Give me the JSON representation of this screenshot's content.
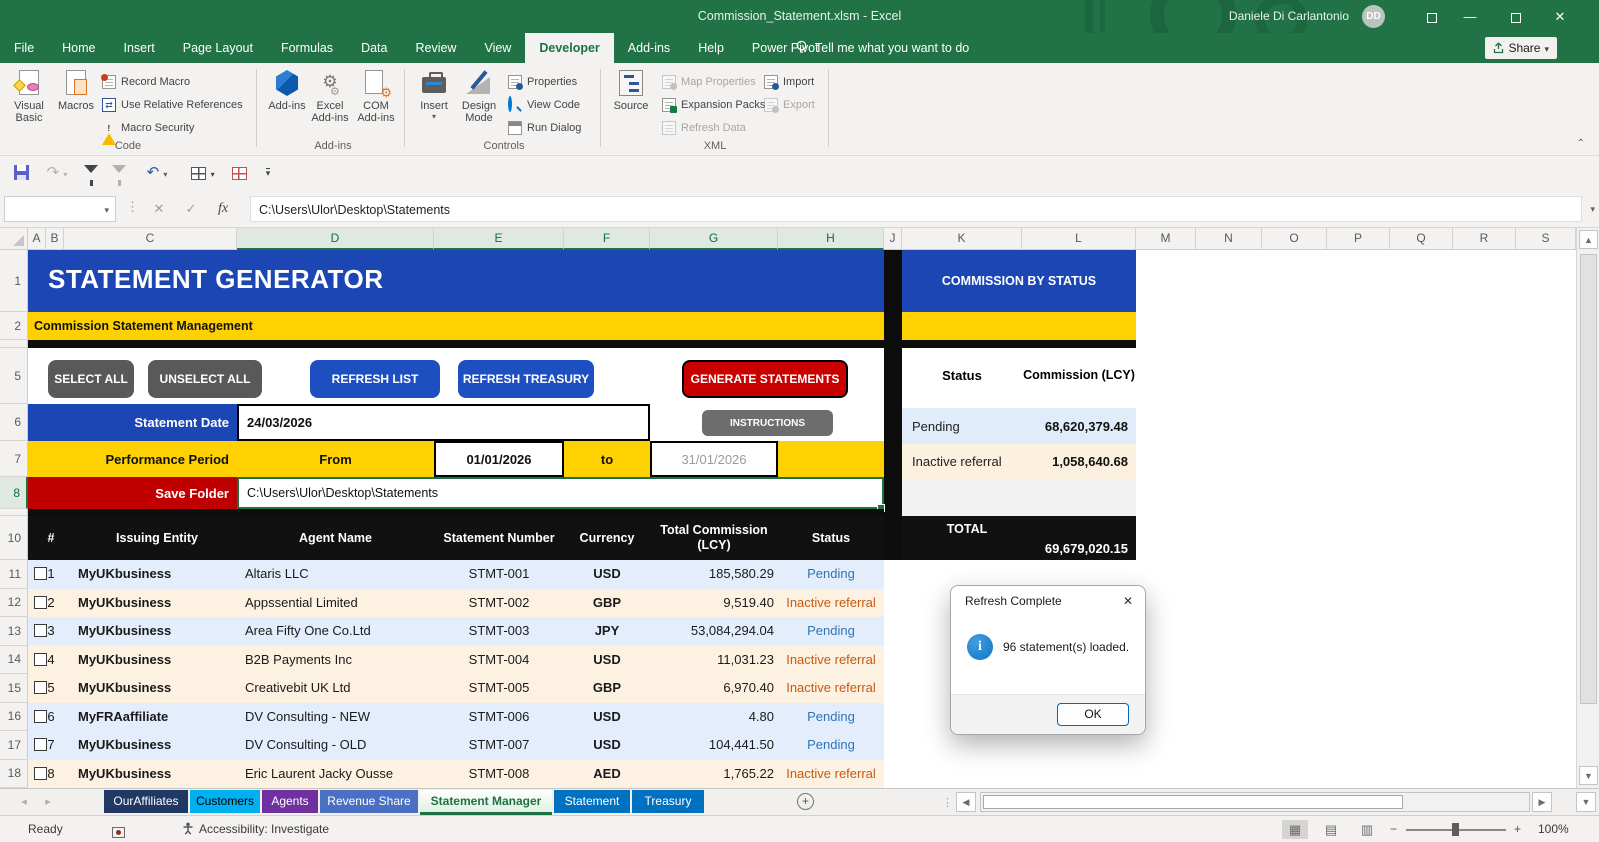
{
  "colors": {
    "excel_green": "#217346",
    "banner_blue": "#1c46b4",
    "banner_yellow": "#ffd100",
    "alert_red": "#c00000",
    "pending_blue": "#2e75b6",
    "inactive_orange": "#c55a11",
    "pending_row_bg": "#e4edfb",
    "inactive_row_bg": "#fdf2e2"
  },
  "title_bar": {
    "title": "Commission_Statement.xlsm  -  Excel",
    "user": "Daniele Di Carlantonio",
    "initials": "DD"
  },
  "ribbon_tabs": {
    "items": [
      "File",
      "Home",
      "Insert",
      "Page Layout",
      "Formulas",
      "Data",
      "Review",
      "View",
      "Developer",
      "Add-ins",
      "Help",
      "Power Pivot"
    ],
    "active": "Developer",
    "tell_me": "Tell me what you want to do",
    "share": "Share"
  },
  "ribbon": {
    "code": {
      "label": "Code",
      "visual_basic": "Visual Basic",
      "macros": "Macros",
      "record_macro": "Record Macro",
      "use_relative_references": "Use Relative References",
      "macro_security": "Macro Security"
    },
    "addins": {
      "label": "Add-ins",
      "add_ins": "Add-ins",
      "excel_add_ins": "Excel Add-ins",
      "com_add_ins": "COM Add-ins"
    },
    "controls": {
      "label": "Controls",
      "insert": "Insert",
      "design_mode": "Design Mode",
      "properties": "Properties",
      "view_code": "View Code",
      "run_dialog": "Run Dialog"
    },
    "xml": {
      "label": "XML",
      "source": "Source",
      "map_properties": "Map Properties",
      "expansion_packs": "Expansion Packs",
      "refresh_data": "Refresh Data",
      "import": "Import",
      "export": "Export"
    }
  },
  "formula_bar": {
    "name_box": "",
    "fx_label": "fx",
    "value": "C:\\Users\\Ulor\\Desktop\\Statements"
  },
  "grid": {
    "columns": [
      "A",
      "B",
      "C",
      "D",
      "E",
      "F",
      "G",
      "H",
      "J",
      "K",
      "L",
      "M",
      "N",
      "O",
      "P",
      "Q",
      "R",
      "S"
    ],
    "rows": [
      "1",
      "2",
      "5",
      "6",
      "7",
      "8",
      "10",
      "11",
      "12",
      "13",
      "14",
      "15",
      "16",
      "17",
      "18"
    ]
  },
  "generator": {
    "title": "STATEMENT GENERATOR",
    "subtitle": "Commission Statement Management",
    "buttons": {
      "select_all": "SELECT ALL",
      "unselect_all": "UNSELECT ALL",
      "refresh_list": "REFRESH LIST",
      "refresh_treasury": "REFRESH TREASURY",
      "generate": "GENERATE STATEMENTS",
      "instructions": "INSTRUCTIONS"
    },
    "statement_date": {
      "label": "Statement Date",
      "value": "24/03/2026"
    },
    "performance_period": {
      "label": "Performance Period",
      "from_label": "From",
      "from_value": "01/01/2026",
      "to_label": "to",
      "to_value": "31/01/2026"
    },
    "save_folder": {
      "label": "Save Folder",
      "value": "C:\\Users\\Ulor\\Desktop\\Statements"
    }
  },
  "table": {
    "headers": {
      "num": "#",
      "issuing_entity": "Issuing Entity",
      "agent_name": "Agent Name",
      "statement_number": "Statement Number",
      "currency": "Currency",
      "total_commission": "Total Commission (LCY)",
      "status": "Status"
    },
    "rows": [
      {
        "num": "1",
        "entity": "MyUKbusiness",
        "agent": "Altaris LLC",
        "stmt": "STMT-001",
        "ccy": "USD",
        "amount": "185,580.29",
        "status": "Pending",
        "status_color": "#2e75b6",
        "bg": "#e4edfb"
      },
      {
        "num": "2",
        "entity": "MyUKbusiness",
        "agent": "Appssential Limited",
        "stmt": "STMT-002",
        "ccy": "GBP",
        "amount": "9,519.40",
        "status": "Inactive referral",
        "status_color": "#c55a11",
        "bg": "#fdf2e2"
      },
      {
        "num": "3",
        "entity": "MyUKbusiness",
        "agent": "Area Fifty One Co.Ltd",
        "stmt": "STMT-003",
        "ccy": "JPY",
        "amount": "53,084,294.04",
        "status": "Pending",
        "status_color": "#2e75b6",
        "bg": "#e4edfb"
      },
      {
        "num": "4",
        "entity": "MyUKbusiness",
        "agent": "B2B Payments Inc",
        "stmt": "STMT-004",
        "ccy": "USD",
        "amount": "11,031.23",
        "status": "Inactive referral",
        "status_color": "#c55a11",
        "bg": "#fdf2e2"
      },
      {
        "num": "5",
        "entity": "MyUKbusiness",
        "agent": "Creativebit UK Ltd",
        "stmt": "STMT-005",
        "ccy": "GBP",
        "amount": "6,970.40",
        "status": "Inactive referral",
        "status_color": "#c55a11",
        "bg": "#fdf2e2"
      },
      {
        "num": "6",
        "entity": "MyFRAaffiliate",
        "agent": "DV Consulting - NEW",
        "stmt": "STMT-006",
        "ccy": "USD",
        "amount": "4.80",
        "status": "Pending",
        "status_color": "#2e75b6",
        "bg": "#e4edfb"
      },
      {
        "num": "7",
        "entity": "MyUKbusiness",
        "agent": "DV Consulting - OLD",
        "stmt": "STMT-007",
        "ccy": "USD",
        "amount": "104,441.50",
        "status": "Pending",
        "status_color": "#2e75b6",
        "bg": "#e4edfb"
      },
      {
        "num": "8",
        "entity": "MyUKbusiness",
        "agent": "Eric Laurent Jacky Ousse",
        "stmt": "STMT-008",
        "ccy": "AED",
        "amount": "1,765.22",
        "status": "Inactive referral",
        "status_color": "#c55a11",
        "bg": "#fdf2e2"
      }
    ]
  },
  "status_panel": {
    "title": "COMMISSION BY STATUS",
    "col_status": "Status",
    "col_commission": "Commission (LCY)",
    "rows": [
      {
        "status": "Pending",
        "amount": "68,620,379.48",
        "bg": "#e0ecfa"
      },
      {
        "status": "Inactive referral",
        "amount": "1,058,640.68",
        "bg": "#fcf0de"
      }
    ],
    "total_label": "TOTAL",
    "total_value": "69,679,020.15"
  },
  "dialog": {
    "title": "Refresh Complete",
    "message": "96 statement(s) loaded.",
    "ok": "OK"
  },
  "sheet_tabs": {
    "items": [
      {
        "label": "OurAffiliates",
        "bg": "#1f3864",
        "fg": "#ffffff"
      },
      {
        "label": "Customers",
        "bg": "#00b0f0",
        "fg": "#000000"
      },
      {
        "label": "Agents",
        "bg": "#7030a0",
        "fg": "#ffffff"
      },
      {
        "label": "Revenue Share",
        "bg": "#4a6fc3",
        "fg": "#ffffff"
      },
      {
        "label": "Statement Manager",
        "bg": "",
        "fg": "#1e7145"
      },
      {
        "label": "Statement",
        "bg": "#0070c0",
        "fg": "#ffffff"
      },
      {
        "label": "Treasury",
        "bg": "#0070c0",
        "fg": "#ffffff"
      }
    ],
    "active": "Statement Manager"
  },
  "status_bar": {
    "ready": "Ready",
    "accessibility": "Accessibility: Investigate",
    "zoom": "100%"
  }
}
